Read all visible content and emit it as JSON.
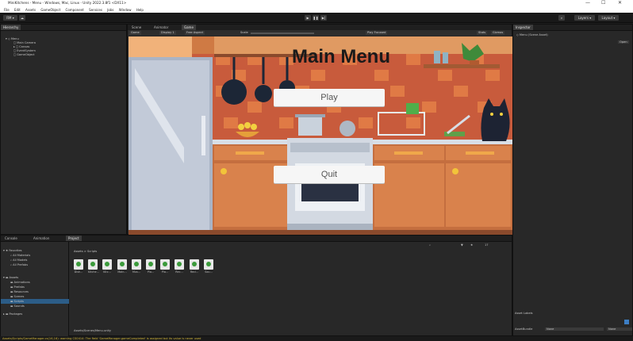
{
  "window": {
    "title": "MiniKitchens - Menu - Windows, Mac, Linux - Unity 2022.3.8f1 <DX11>",
    "controls": [
      "—",
      "☐",
      "✕"
    ]
  },
  "menubar": [
    "File",
    "Edit",
    "Assets",
    "GameObject",
    "Component",
    "Services",
    "Jobs",
    "Window",
    "Help"
  ],
  "toolbar": {
    "account": "RM ▾",
    "layers": "Layers ▾",
    "layout": "Layout ▾"
  },
  "hierarchy": {
    "tab": "Hierarchy",
    "items": [
      "Menu",
      "Main Camera",
      "Canvas",
      "EventSystem",
      "GameObject"
    ]
  },
  "scene_tabs": [
    "Scene",
    "Animator",
    "Game"
  ],
  "scene_toolbar": {
    "game": "Game",
    "display": "Display 1",
    "aspect": "Free Aspect",
    "scale": "Scale",
    "play_focused": "Play Focused",
    "stats": "Stats",
    "gizmos": "Gizmos"
  },
  "game_ui": {
    "title": "Main Menu",
    "play": "Play",
    "quit": "Quit"
  },
  "inspector": {
    "tab": "Inspector",
    "object": "Menu (Scene Asset)",
    "open": "Open",
    "asset_labels": "Asset Labels",
    "asset_bundle": "AssetBundle",
    "bundle_value": "None",
    "bundle_variant": "None"
  },
  "bottom_tabs": [
    "Console",
    "Animation",
    "Project"
  ],
  "project": {
    "favorites": [
      "Favorites",
      "All Materials",
      "All Models",
      "All Prefabs"
    ],
    "assets_tree": [
      "Assets",
      "Animations",
      "Prefabs",
      "Resources",
      "Scenes",
      "Scripts",
      "Sounds",
      "Packages"
    ],
    "breadcrumb": "Assets > Scripts",
    "files": [
      "Dish...",
      "Kitche...",
      "Kitc...",
      "Main...",
      "Mus...",
      "Pla...",
      "Pla...",
      "Rec...",
      "Reci...",
      "Sou..."
    ],
    "path": "Assets/Scenes/Menu.unity",
    "count": "17"
  },
  "status": {
    "message": "Assets/Scripts/GameManager.cs(16,16): warning CS0414: The field 'GameManager.gameCompleted' is assigned but its value is never used"
  },
  "colors": {
    "panel": "#282828",
    "toolbar": "#191919",
    "accent": "#2c5d87",
    "warning": "#d4b83a"
  }
}
